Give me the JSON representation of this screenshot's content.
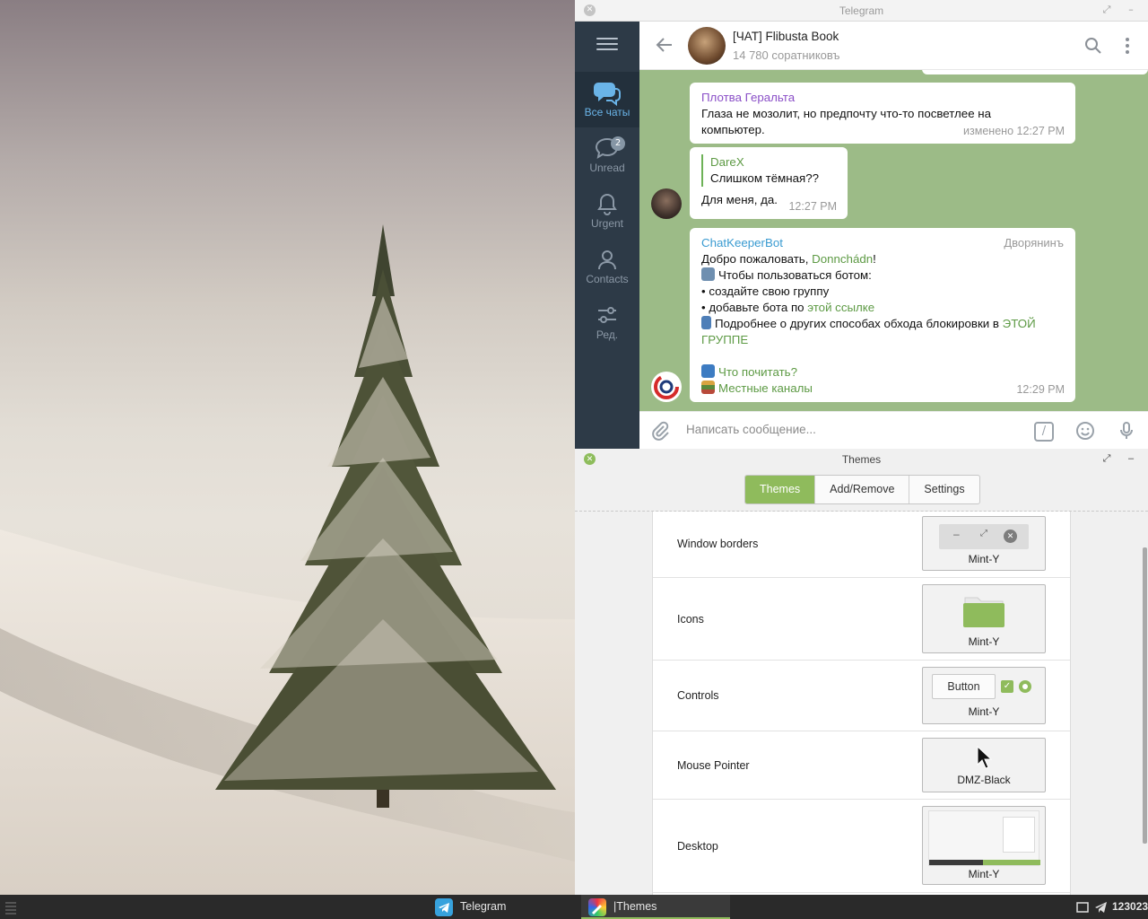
{
  "telegram": {
    "window_title": "Telegram",
    "folders": [
      {
        "label": "Все чаты",
        "icon": "chats-icon",
        "active": true
      },
      {
        "label": "Unread",
        "icon": "unread-bubble-icon",
        "badge": "2"
      },
      {
        "label": "Urgent",
        "icon": "bell-icon"
      },
      {
        "label": "Contacts",
        "icon": "person-icon"
      },
      {
        "label": "Ред.",
        "icon": "edit-sliders-icon"
      }
    ],
    "chat": {
      "title": "[ЧАТ] Flibusta Book",
      "members": "14 780 соратниковъ"
    },
    "messages": [
      {
        "sender": "Плотва Геральта",
        "sender_color": "#8a4fc7",
        "text": "Глаза не мозолит, но предпочту что-то посветлее на компьютер.",
        "time": "изменено 12:27 PM"
      },
      {
        "reply_to": "DareX",
        "reply_text": "Слишком тёмная??",
        "text": "Для меня, да.",
        "time": "12:27 PM"
      },
      {
        "sender": "ChatKeeperBot",
        "sender_color": "#3a9bd1",
        "badge": "Дворянинъ",
        "line1_prefix": "Добро пожаловать, ",
        "line1_user": "Donnchádn",
        "line1_suffix": "!",
        "line2": "Чтобы пользоваться ботом:",
        "line3": "• создайте свою группу",
        "line4_prefix": "• добавьте бота по ",
        "line4_link": "этой ссылке",
        "line5_prefix": "Подробнее о других способах обхода блокировки в ",
        "line5_link": "ЭТОЙ ГРУППЕ",
        "link1": "Что почитать?",
        "link2": "Местные каналы",
        "time": "12:29 PM"
      }
    ],
    "input_placeholder": "Написать сообщение...",
    "command_glyph": "/"
  },
  "themes": {
    "window_title": "Themes",
    "tabs": [
      {
        "label": "Themes",
        "active": true
      },
      {
        "label": "Add/Remove"
      },
      {
        "label": "Settings"
      }
    ],
    "rows": [
      {
        "label": "Window borders",
        "value": "Mint-Y"
      },
      {
        "label": "Icons",
        "value": "Mint-Y"
      },
      {
        "label": "Controls",
        "value": "Mint-Y",
        "button_label": "Button"
      },
      {
        "label": "Mouse Pointer",
        "value": "DMZ-Black"
      },
      {
        "label": "Desktop",
        "value": "Mint-Y"
      }
    ]
  },
  "taskbar": {
    "items": [
      {
        "label": "Telegram",
        "icon": "telegram-icon"
      },
      {
        "label": "|Themes",
        "icon": "themes-icon",
        "active": true
      }
    ],
    "clock": "123023"
  },
  "colors": {
    "accent": "#8fbb5c",
    "chat_background": "#9cbb87",
    "telegram_sidebar": "#2d3a47"
  }
}
